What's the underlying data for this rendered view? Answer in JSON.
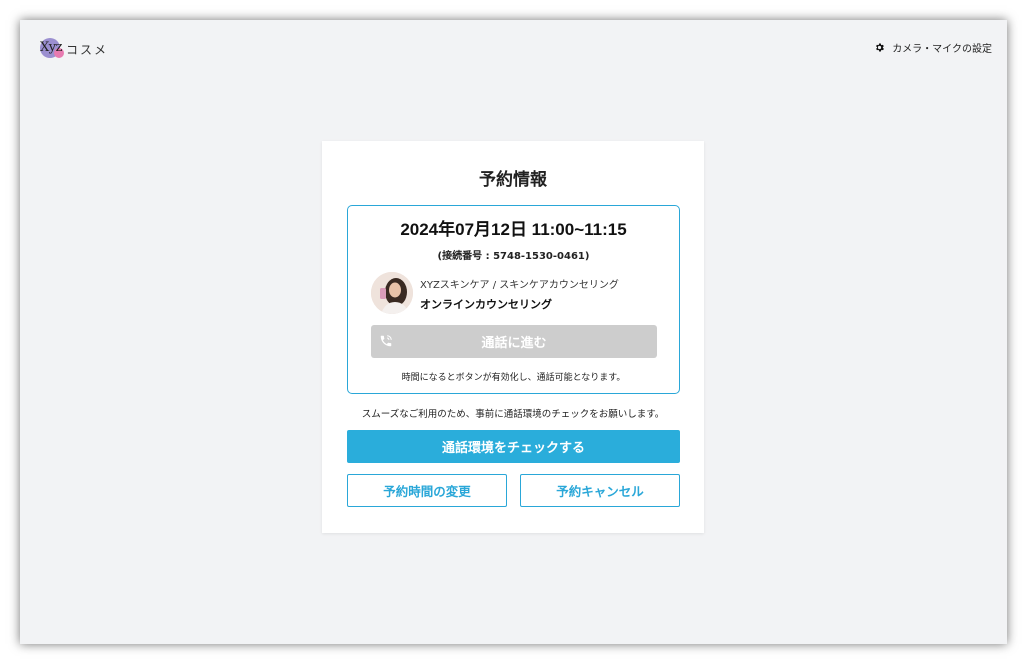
{
  "header": {
    "logo_mark": "Xyz",
    "logo_text": "コスメ",
    "settings_label": "カメラ・マイクの設定",
    "settings_icon": "gear-icon"
  },
  "card": {
    "title": "予約情報",
    "reservation": {
      "datetime": "2024年07月12日 11:00~11:15",
      "connection_number": "(接続番号 : 5748-1530-0461)",
      "plan_name": "XYZスキンケア / スキンケアカウンセリング",
      "plan_type": "オンラインカウンセリング",
      "call_button_label": "通話に進む",
      "call_button_icon": "phone-icon",
      "note": "時間になるとボタンが有効化し、通話可能となります。"
    },
    "guide_text": "スムーズなご利用のため、事前に通話環境のチェックをお願いします。",
    "check_button_label": "通話環境をチェックする",
    "change_button_label": "予約時間の変更",
    "cancel_button_label": "予約キャンセル"
  },
  "colors": {
    "accent": "#2aaddb",
    "disabled": "#cdcdcd",
    "background": "#f2f3f5"
  }
}
